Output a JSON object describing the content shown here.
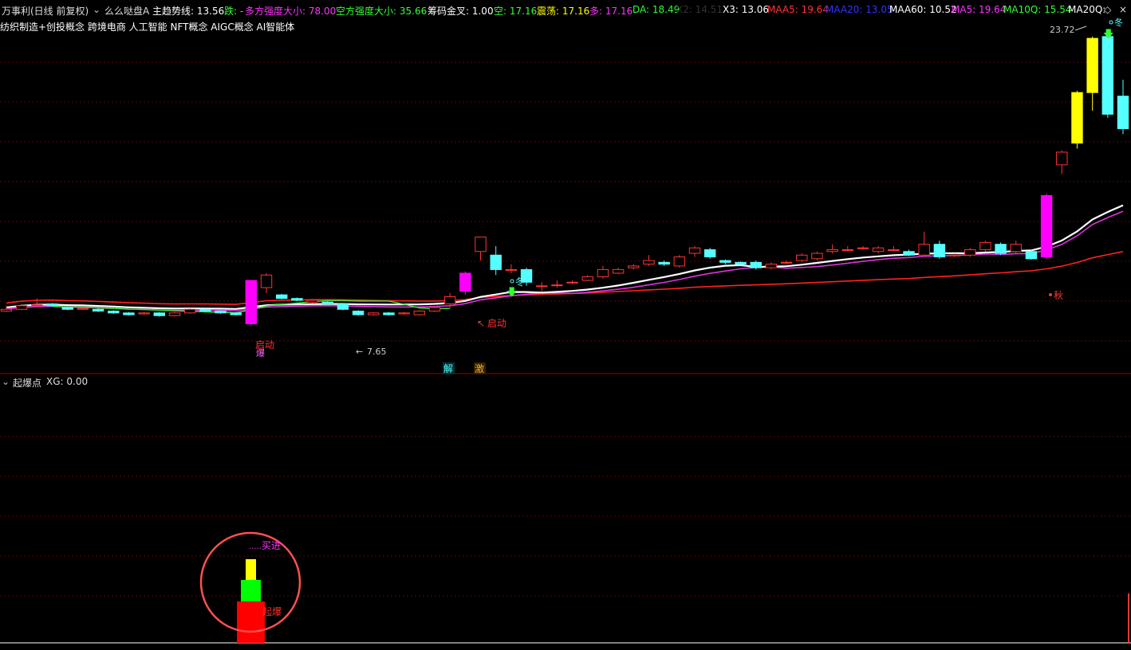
{
  "header": {
    "stock": "万事利(日线 前复权)",
    "indicator": "么么哒盘A",
    "items": [
      {
        "label": "主趋势线: 13.56",
        "color": "#ffffff"
      },
      {
        "label": "跌: -",
        "color": "#33ff33"
      },
      {
        "label": "多方强度大小: 78.00",
        "color": "#ff33ff"
      },
      {
        "label": "空方强度大小: 35.66",
        "color": "#33ff33"
      },
      {
        "label": "筹码金叉: 1.00",
        "color": "#ffffff"
      },
      {
        "label": "空: 17.16",
        "color": "#33ff33"
      },
      {
        "label": "震荡: 17.16",
        "color": "#ffff00"
      },
      {
        "label": "多: 17.16",
        "color": "#ff33ff"
      },
      {
        "label": "DA: 18.49",
        "color": "#33ff33"
      },
      {
        "label": "X2: 14.51",
        "color": "#333333"
      },
      {
        "label": "X3: 13.06",
        "color": "#ffffff"
      },
      {
        "label": "MAA5: 19.64",
        "color": "#ff3333"
      },
      {
        "label": "MAA20: 13.05",
        "color": "#3333ff"
      },
      {
        "label": "MAA60: 10.52",
        "color": "#ffffff"
      },
      {
        "label": "MA5: 19.64",
        "color": "#ff33ff"
      },
      {
        "label": "MA10Q: 15.54",
        "color": "#33ff33"
      },
      {
        "label": "MA20Q:",
        "color": "#ffffff"
      }
    ]
  },
  "concepts": "纺织制造+创投概念 跨境电商 人工智能 NFT概念 AIGC概念 AI智能体",
  "sub_panel": {
    "title": "起爆点",
    "value": "XG: 0.00"
  },
  "annotations": {
    "max_label": "23.72",
    "min_label": "7.65",
    "start1": "启动",
    "start2": "启动",
    "jie": "解",
    "ji": "激",
    "winter1": "冬",
    "winter2": "冬",
    "autumn": "秋",
    "buy": "买进",
    "qibao": "起爆"
  },
  "colors": {
    "up": "#ff3333",
    "down": "#55ffff",
    "yellow": "#ffff00",
    "magenta": "#ff00ff",
    "white": "#ffffff",
    "grid": "#8b0000"
  },
  "chart_data": {
    "type": "candlestick",
    "y_axis": "price",
    "ylim": [
      6.5,
      24.8
    ],
    "candles": [
      [
        8.9,
        9.0,
        8.85,
        9.2
      ],
      [
        9.0,
        9.2,
        8.95,
        9.3
      ],
      [
        9.2,
        9.25,
        9.15,
        9.6
      ],
      [
        9.3,
        9.2,
        9.15,
        9.35
      ],
      [
        9.1,
        9.0,
        8.95,
        9.15
      ],
      [
        9.0,
        9.05,
        8.95,
        9.1
      ],
      [
        9.0,
        8.9,
        8.85,
        9.05
      ],
      [
        8.9,
        8.8,
        8.75,
        8.95
      ],
      [
        8.8,
        8.7,
        8.65,
        8.85
      ],
      [
        8.75,
        8.8,
        8.7,
        8.85
      ],
      [
        8.8,
        8.65,
        8.6,
        8.85
      ],
      [
        8.65,
        8.8,
        8.6,
        8.85
      ],
      [
        8.8,
        9.0,
        8.75,
        9.05
      ],
      [
        9.0,
        8.9,
        8.85,
        9.05
      ],
      [
        8.9,
        8.8,
        8.75,
        8.95
      ],
      [
        8.8,
        8.7,
        8.65,
        8.85
      ],
      [
        8.2,
        10.6,
        8.1,
        10.6
      ],
      [
        10.2,
        10.9,
        9.9,
        11.0
      ],
      [
        9.8,
        9.6,
        9.55,
        9.85
      ],
      [
        9.6,
        9.5,
        9.45,
        9.65
      ],
      [
        9.4,
        9.5,
        9.35,
        9.55
      ],
      [
        9.4,
        9.3,
        9.25,
        9.45
      ],
      [
        9.3,
        9.0,
        8.95,
        9.35
      ],
      [
        8.9,
        8.7,
        8.65,
        8.95
      ],
      [
        8.7,
        8.8,
        8.65,
        8.85
      ],
      [
        8.8,
        8.7,
        8.65,
        8.85
      ],
      [
        8.75,
        8.8,
        8.7,
        8.85
      ],
      [
        8.7,
        8.9,
        8.65,
        8.95
      ],
      [
        8.9,
        9.1,
        8.85,
        9.15
      ],
      [
        9.3,
        9.7,
        9.1,
        9.9
      ],
      [
        10.0,
        11.0,
        9.8,
        11.1
      ],
      [
        12.2,
        13.0,
        11.7,
        13.0
      ],
      [
        12.0,
        11.2,
        10.9,
        12.5
      ],
      [
        11.2,
        11.2,
        11.0,
        11.5
      ],
      [
        11.2,
        10.5,
        10.3,
        11.3
      ],
      [
        10.3,
        10.3,
        10.0,
        10.5
      ],
      [
        10.35,
        10.35,
        10.2,
        10.6
      ],
      [
        10.5,
        10.5,
        10.4,
        10.6
      ],
      [
        10.6,
        10.8,
        10.55,
        10.9
      ],
      [
        10.8,
        11.2,
        10.7,
        11.4
      ],
      [
        11.0,
        11.2,
        10.95,
        11.3
      ],
      [
        11.3,
        11.4,
        11.2,
        11.5
      ],
      [
        11.5,
        11.7,
        11.4,
        12.0
      ],
      [
        11.6,
        11.5,
        11.4,
        11.7
      ],
      [
        11.4,
        11.9,
        11.3,
        12.0
      ],
      [
        12.1,
        12.4,
        11.9,
        12.5
      ],
      [
        12.3,
        11.9,
        11.8,
        12.4
      ],
      [
        11.7,
        11.6,
        11.5,
        11.75
      ],
      [
        11.6,
        11.5,
        11.45,
        11.65
      ],
      [
        11.6,
        11.3,
        11.2,
        11.7
      ],
      [
        11.3,
        11.5,
        11.2,
        11.6
      ],
      [
        11.6,
        11.6,
        11.5,
        11.7
      ],
      [
        11.7,
        12.0,
        11.6,
        12.1
      ],
      [
        11.8,
        12.1,
        11.7,
        12.2
      ],
      [
        12.2,
        12.3,
        12.1,
        12.6
      ],
      [
        12.3,
        12.3,
        12.2,
        12.5
      ],
      [
        12.4,
        12.4,
        12.3,
        12.5
      ],
      [
        12.2,
        12.4,
        12.1,
        12.5
      ],
      [
        12.3,
        12.3,
        12.25,
        12.5
      ],
      [
        12.2,
        12.0,
        11.95,
        12.3
      ],
      [
        12.0,
        12.6,
        11.9,
        13.3
      ],
      [
        12.6,
        11.9,
        11.8,
        12.8
      ],
      [
        12.0,
        12.0,
        11.9,
        12.1
      ],
      [
        12.0,
        12.3,
        11.9,
        12.4
      ],
      [
        12.3,
        12.7,
        12.2,
        12.8
      ],
      [
        12.6,
        12.1,
        12.0,
        12.7
      ],
      [
        12.2,
        12.6,
        12.1,
        12.8
      ],
      [
        12.2,
        11.8,
        11.75,
        12.3
      ],
      [
        11.9,
        15.3,
        11.8,
        15.4
      ],
      [
        17.0,
        17.7,
        16.5,
        17.8
      ],
      [
        18.2,
        21.0,
        17.9,
        21.1
      ],
      [
        21.0,
        24.0,
        20.0,
        24.1
      ],
      [
        24.1,
        19.8,
        19.6,
        24.2
      ],
      [
        20.8,
        19.0,
        18.7,
        21.7
      ]
    ],
    "series": [
      {
        "name": "MAA60",
        "color": "#ffffff"
      },
      {
        "name": "MA5",
        "color": "#ff33ff"
      },
      {
        "name": "MA10Q",
        "color": "#33ff33"
      },
      {
        "name": "MAA5",
        "color": "#ff3333"
      }
    ],
    "sub_panel": {
      "type": "bar",
      "events": [
        "起爆",
        "买进"
      ]
    }
  }
}
